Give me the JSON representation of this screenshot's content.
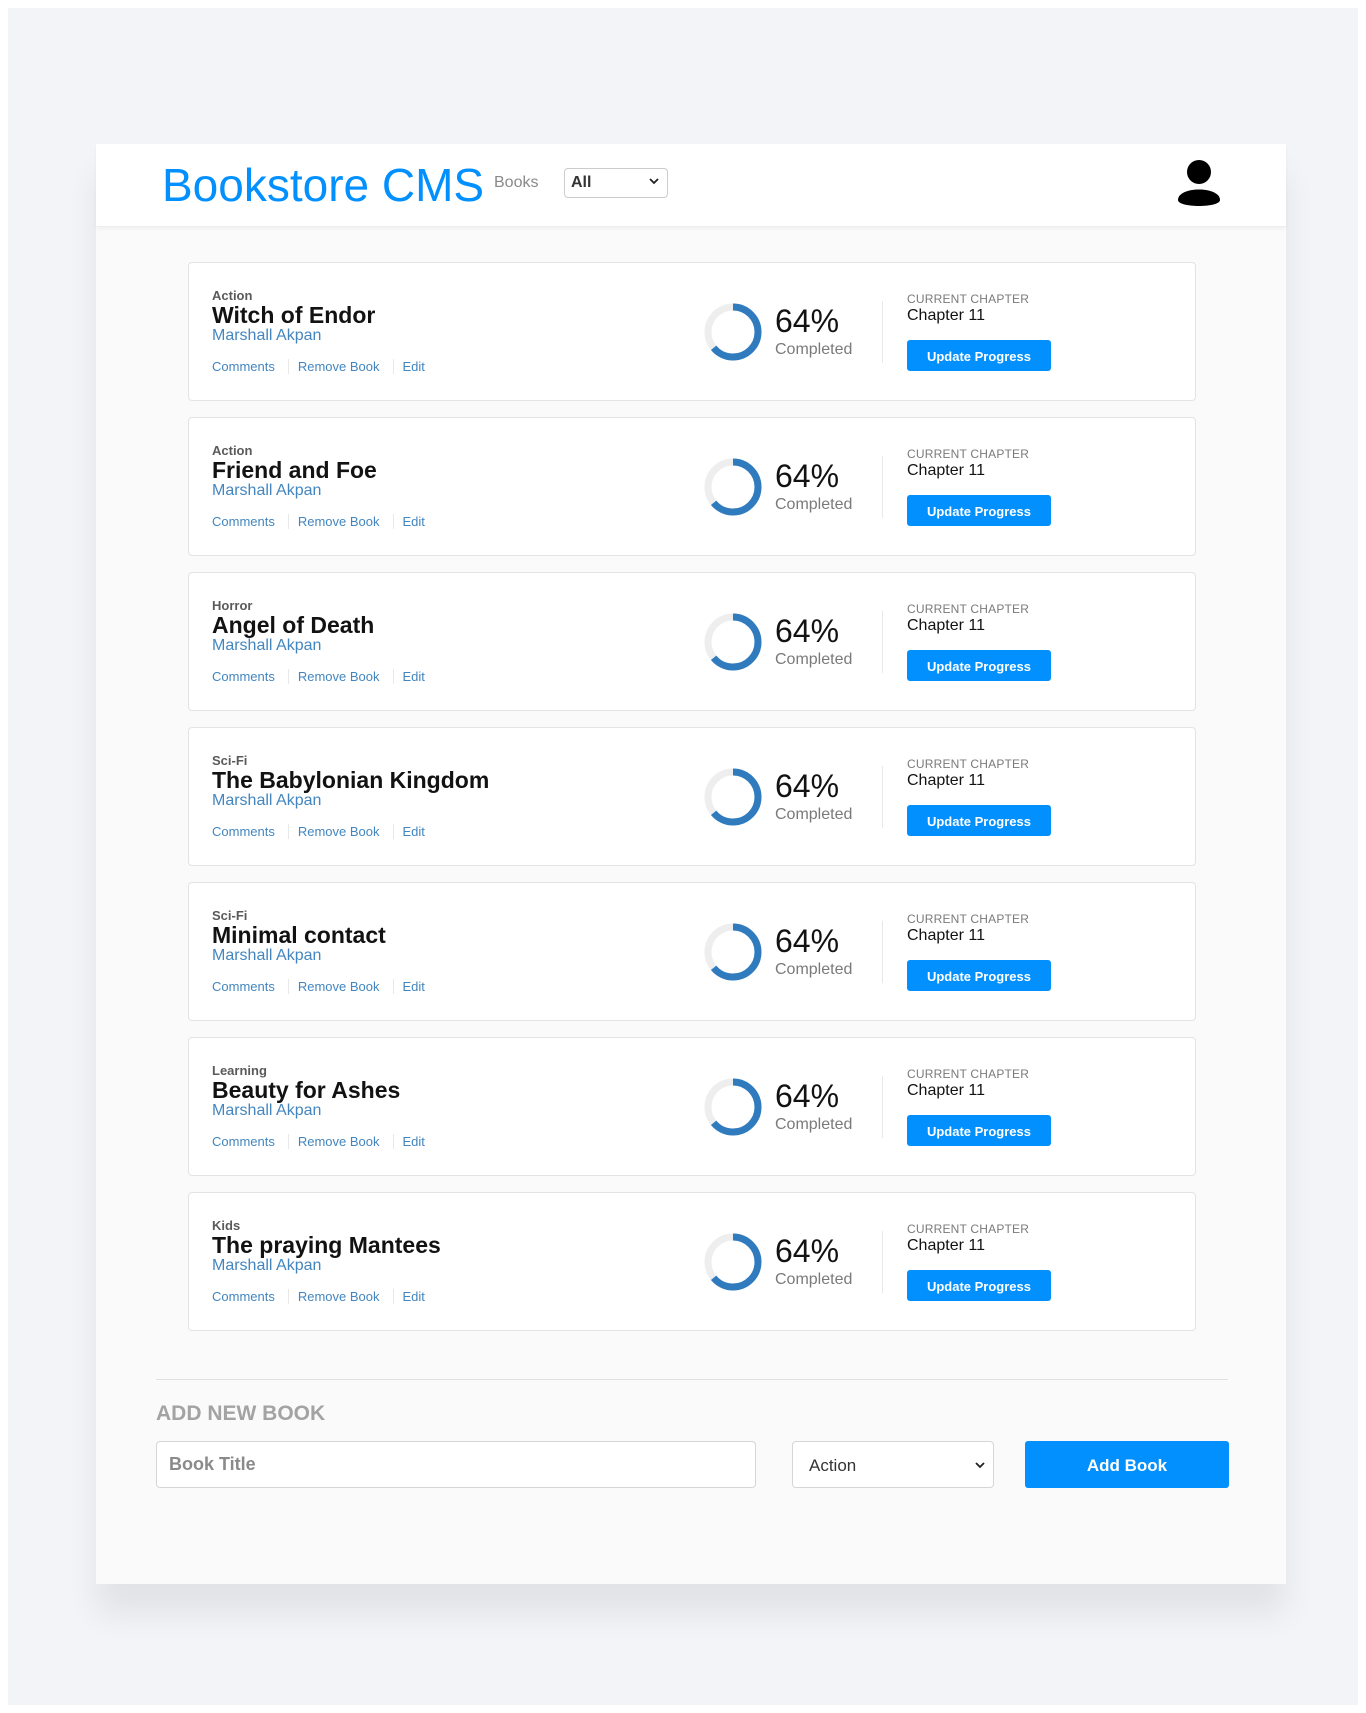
{
  "header": {
    "logo": "Bookstore CMS",
    "nav_books": "Books",
    "filter": {
      "selected": "All"
    },
    "user_icon": "user-icon"
  },
  "books": [
    {
      "genre": "Action",
      "title": "Witch of Endor",
      "author": "Marshall Akpan",
      "progress_percent": 64,
      "progress_label": "64%",
      "completed_label": "Completed",
      "current_chapter_label": "CURRENT CHAPTER",
      "current_chapter": "Chapter 11",
      "update_label": "Update Progress",
      "comments_label": "Comments",
      "remove_label": "Remove Book",
      "edit_label": "Edit"
    },
    {
      "genre": "Action",
      "title": "Friend and Foe",
      "author": "Marshall Akpan",
      "progress_percent": 64,
      "progress_label": "64%",
      "completed_label": "Completed",
      "current_chapter_label": "CURRENT CHAPTER",
      "current_chapter": "Chapter 11",
      "update_label": "Update Progress",
      "comments_label": "Comments",
      "remove_label": "Remove Book",
      "edit_label": "Edit"
    },
    {
      "genre": "Horror",
      "title": "Angel of Death",
      "author": "Marshall Akpan",
      "progress_percent": 64,
      "progress_label": "64%",
      "completed_label": "Completed",
      "current_chapter_label": "CURRENT CHAPTER",
      "current_chapter": "Chapter 11",
      "update_label": "Update Progress",
      "comments_label": "Comments",
      "remove_label": "Remove Book",
      "edit_label": "Edit"
    },
    {
      "genre": "Sci-Fi",
      "title": "The Babylonian Kingdom",
      "author": "Marshall Akpan",
      "progress_percent": 64,
      "progress_label": "64%",
      "completed_label": "Completed",
      "current_chapter_label": "CURRENT CHAPTER",
      "current_chapter": "Chapter 11",
      "update_label": "Update Progress",
      "comments_label": "Comments",
      "remove_label": "Remove Book",
      "edit_label": "Edit"
    },
    {
      "genre": "Sci-Fi",
      "title": "Minimal contact",
      "author": "Marshall Akpan",
      "progress_percent": 64,
      "progress_label": "64%",
      "completed_label": "Completed",
      "current_chapter_label": "CURRENT CHAPTER",
      "current_chapter": "Chapter 11",
      "update_label": "Update Progress",
      "comments_label": "Comments",
      "remove_label": "Remove Book",
      "edit_label": "Edit"
    },
    {
      "genre": "Learning",
      "title": "Beauty for Ashes",
      "author": "Marshall Akpan",
      "progress_percent": 64,
      "progress_label": "64%",
      "completed_label": "Completed",
      "current_chapter_label": "CURRENT CHAPTER",
      "current_chapter": "Chapter 11",
      "update_label": "Update Progress",
      "comments_label": "Comments",
      "remove_label": "Remove Book",
      "edit_label": "Edit"
    },
    {
      "genre": "Kids",
      "title": "The praying Mantees",
      "author": "Marshall Akpan",
      "progress_percent": 64,
      "progress_label": "64%",
      "completed_label": "Completed",
      "current_chapter_label": "CURRENT CHAPTER",
      "current_chapter": "Chapter 11",
      "update_label": "Update Progress",
      "comments_label": "Comments",
      "remove_label": "Remove Book",
      "edit_label": "Edit"
    }
  ],
  "add_form": {
    "heading": "ADD NEW BOOK",
    "title_placeholder": "Book Title",
    "category_selected": "Action",
    "submit_label": "Add Book"
  },
  "colors": {
    "accent": "#0290ff",
    "link": "#4386bf",
    "progress": "#307bbe",
    "page_bg": "#f2f4f8"
  }
}
